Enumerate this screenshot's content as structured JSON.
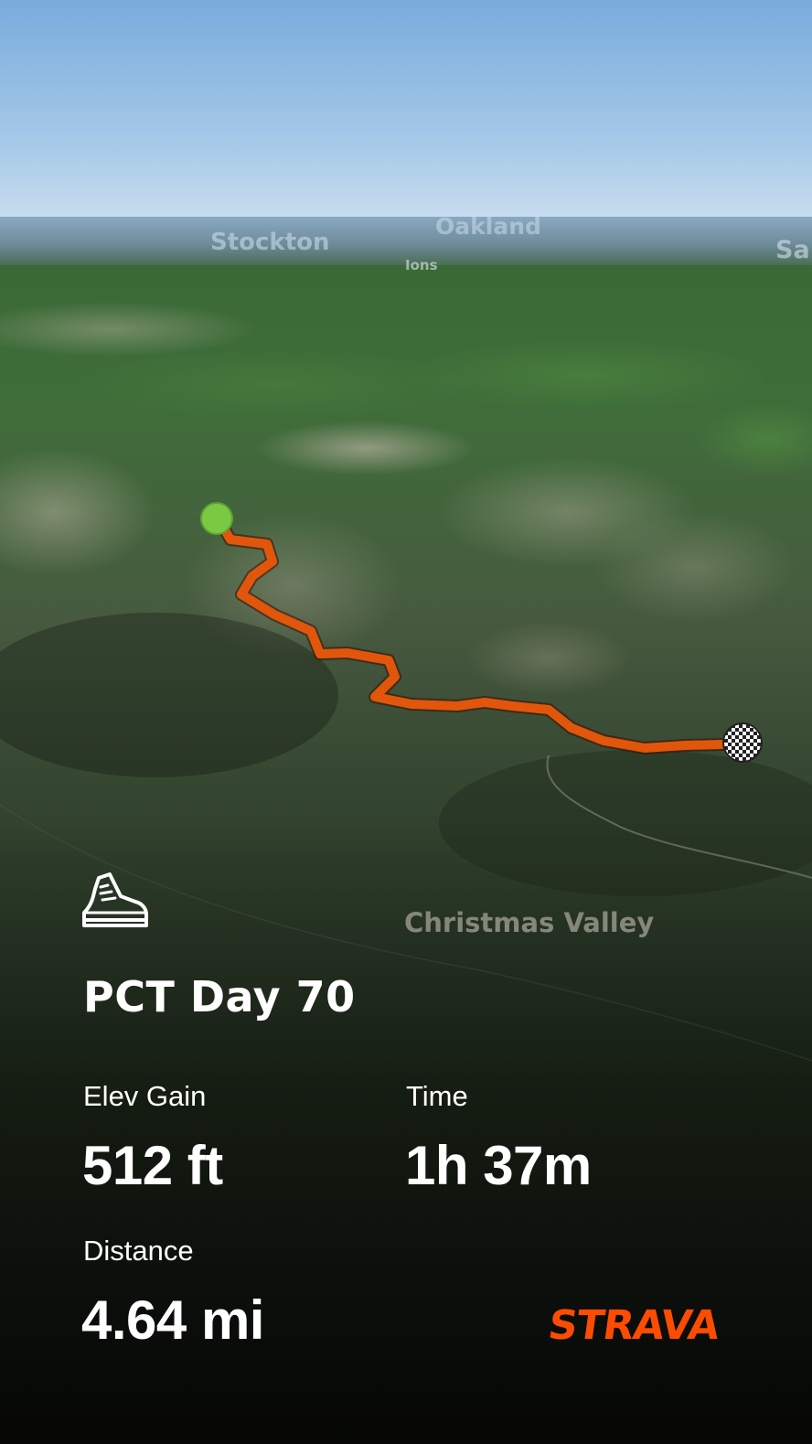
{
  "activity": {
    "type_icon": "hiking-boot-icon",
    "title": "PCT Day 70"
  },
  "map": {
    "labels": {
      "stockton": "Stockton",
      "oakland": "Oakland",
      "ions": "Ions",
      "sa": "Sa",
      "christmas_valley": "Christmas Valley"
    },
    "route_color": "#e2560b",
    "start_marker_color": "#7ac943"
  },
  "stats": {
    "elev_gain": {
      "label": "Elev Gain",
      "value": "512 ft"
    },
    "time": {
      "label": "Time",
      "value": "1h 37m"
    },
    "distance": {
      "label": "Distance",
      "value": "4.64 mi"
    }
  },
  "brand": {
    "name": "STRAVA",
    "color": "#fc4c02"
  }
}
